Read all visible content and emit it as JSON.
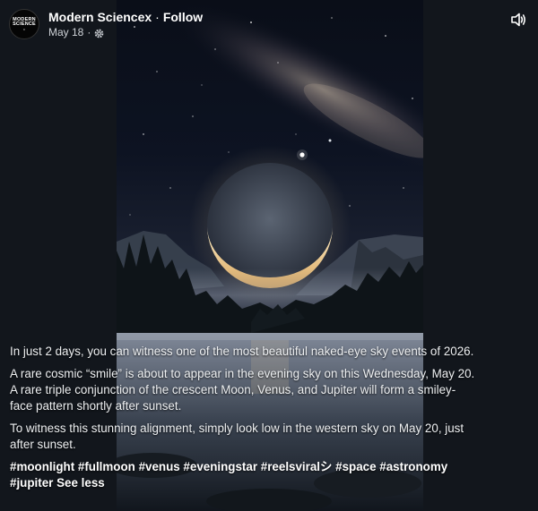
{
  "header": {
    "page_name": "Modern Sciencex",
    "separator": "·",
    "follow_label": "Follow",
    "date": "May 18",
    "date_separator": "·",
    "avatar_text_line1": "MODERN",
    "avatar_text_line2": "SCIENCE",
    "avatar_text_line3": "X",
    "privacy_icon": "globe-settings-icon",
    "sound_icon": "speaker-icon"
  },
  "caption": {
    "paragraph1": "In just 2 days, you can witness one of the most beautiful naked-eye sky events of 2026.",
    "paragraph2": "A rare cosmic “smile” is about to appear in the evening sky on this Wednesday, May 20. A rare triple conjunction of the crescent Moon, Venus, and Jupiter will form a smiley-face pattern shortly after sunset.",
    "paragraph3": "To witness this stunning alignment, simply look low in the western sky on May 20, just after sunset.",
    "hashtags": "#moonlight #fullmoon #venus #eveningstar #reelsviralシ #space #astronomy #jupiter",
    "see_less_label": "See less"
  },
  "colors": {
    "background": "#12161c",
    "text": "#eef0f2",
    "moon_glow": "#f3d9a0"
  }
}
